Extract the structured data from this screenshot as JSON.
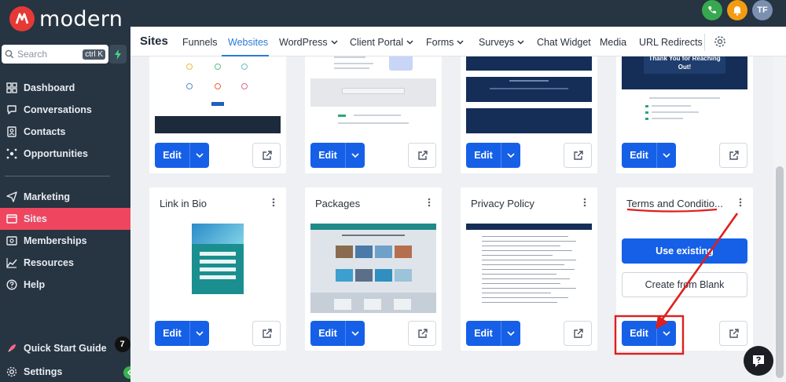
{
  "brand": {
    "name": "modern"
  },
  "sidebar": {
    "search_placeholder": "Search",
    "search_shortcut": "ctrl K",
    "items": [
      {
        "label": "Dashboard",
        "icon": "dashboard-icon"
      },
      {
        "label": "Conversations",
        "icon": "chat-icon"
      },
      {
        "label": "Contacts",
        "icon": "contacts-icon"
      },
      {
        "label": "Opportunities",
        "icon": "opportunities-icon"
      },
      {
        "label": "Marketing",
        "icon": "send-icon"
      },
      {
        "label": "Sites",
        "icon": "sites-icon",
        "active": true
      },
      {
        "label": "Memberships",
        "icon": "memberships-icon"
      },
      {
        "label": "Resources",
        "icon": "chart-icon"
      },
      {
        "label": "Help",
        "icon": "help-icon"
      }
    ],
    "quick_start": {
      "label": "Quick Start Guide",
      "badge": "7"
    },
    "settings": {
      "label": "Settings"
    }
  },
  "topbar": {
    "avatar_initials": "TF"
  },
  "subnav": {
    "title": "Sites",
    "tabs": [
      {
        "label": "Funnels"
      },
      {
        "label": "Websites",
        "active": true
      },
      {
        "label": "WordPress",
        "dropdown": true
      },
      {
        "label": "Client Portal",
        "dropdown": true
      },
      {
        "label": "Forms",
        "dropdown": true
      },
      {
        "label": "Surveys",
        "dropdown": true
      },
      {
        "label": "Chat Widget"
      },
      {
        "label": "Media"
      },
      {
        "label": "URL Redirects"
      }
    ]
  },
  "cards_top": [
    {
      "edit_label": "Edit"
    },
    {
      "edit_label": "Edit"
    },
    {
      "edit_label": "Edit"
    },
    {
      "edit_label": "Edit",
      "thumb_text": "Thank You for Reaching Out!"
    }
  ],
  "cards_bottom": [
    {
      "title": "Link in Bio",
      "edit_label": "Edit"
    },
    {
      "title": "Packages",
      "edit_label": "Edit"
    },
    {
      "title": "Privacy Policy",
      "edit_label": "Edit"
    },
    {
      "title": "Terms and Conditio...",
      "edit_label": "Edit",
      "use_existing": "Use existing",
      "create_blank": "Create from Blank"
    }
  ],
  "annotation_color": "#e01e1e",
  "accent": "#1660e8",
  "sidebar_bg": "#273442",
  "active_nav": "#ef4660"
}
